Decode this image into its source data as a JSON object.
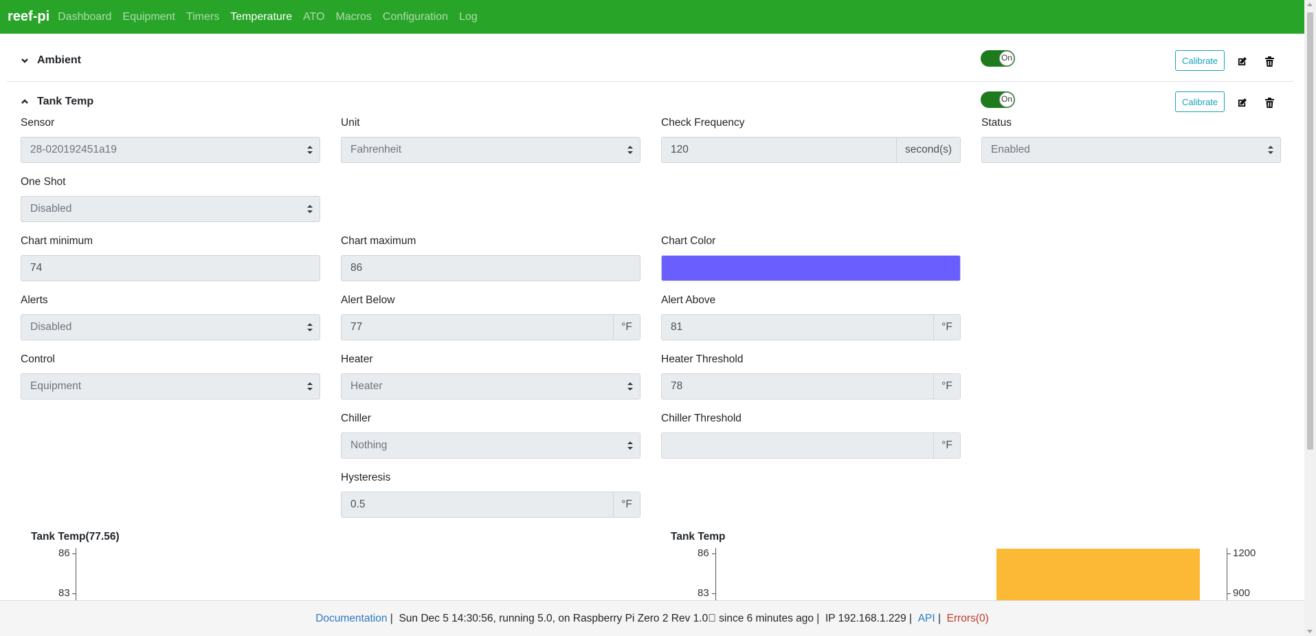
{
  "nav": {
    "brand": "reef-pi",
    "items": [
      "Dashboard",
      "Equipment",
      "Timers",
      "Temperature",
      "ATO",
      "Macros",
      "Configuration",
      "Log"
    ],
    "active": "Temperature"
  },
  "ambient": {
    "title": "Ambient",
    "toggle": "On",
    "calibrate": "Calibrate"
  },
  "tank": {
    "title": "Tank Temp",
    "toggle": "On",
    "calibrate": "Calibrate",
    "sensor": {
      "label": "Sensor",
      "value": "28-020192451a19"
    },
    "unit": {
      "label": "Unit",
      "value": "Fahrenheit"
    },
    "check_frequency": {
      "label": "Check Frequency",
      "value": "120",
      "addon": "second(s)"
    },
    "status": {
      "label": "Status",
      "value": "Enabled"
    },
    "one_shot": {
      "label": "One Shot",
      "value": "Disabled"
    },
    "chart_min": {
      "label": "Chart minimum",
      "value": "74"
    },
    "chart_max": {
      "label": "Chart maximum",
      "value": "86"
    },
    "chart_color": {
      "label": "Chart Color",
      "value": "#6b5eff"
    },
    "alerts": {
      "label": "Alerts",
      "value": "Disabled"
    },
    "alert_below": {
      "label": "Alert Below",
      "value": "77",
      "addon": "°F"
    },
    "alert_above": {
      "label": "Alert Above",
      "value": "81",
      "addon": "°F"
    },
    "control": {
      "label": "Control",
      "value": "Equipment"
    },
    "heater": {
      "label": "Heater",
      "value": "Heater"
    },
    "heater_threshold": {
      "label": "Heater Threshold",
      "value": "78",
      "addon": "°F"
    },
    "chiller": {
      "label": "Chiller",
      "value": "Nothing"
    },
    "chiller_threshold": {
      "label": "Chiller Threshold",
      "value": "",
      "addon": "°F"
    },
    "hysteresis": {
      "label": "Hysteresis",
      "value": "0.5",
      "addon": "°F"
    }
  },
  "chart_data": [
    {
      "type": "line",
      "title": "Tank Temp(77.56)",
      "y_ticks": [
        "86",
        "83"
      ],
      "ylim": [
        83,
        86
      ]
    },
    {
      "type": "bar",
      "title": "Tank Temp",
      "y_ticks_left": [
        "86",
        "83"
      ],
      "y_ticks_right": [
        "1200",
        "900"
      ],
      "bar_color": "#fbb935",
      "values": [
        1200
      ]
    }
  ],
  "footer": {
    "doc": "Documentation",
    "info": "Sun Dec 5 14:30:56,  running 5.0, on Raspberry Pi Zero 2 Rev 1.0\u0000  since 6 minutes ago",
    "ip": "IP 192.168.1.229",
    "api": "API",
    "errors": "Errors(0)"
  }
}
